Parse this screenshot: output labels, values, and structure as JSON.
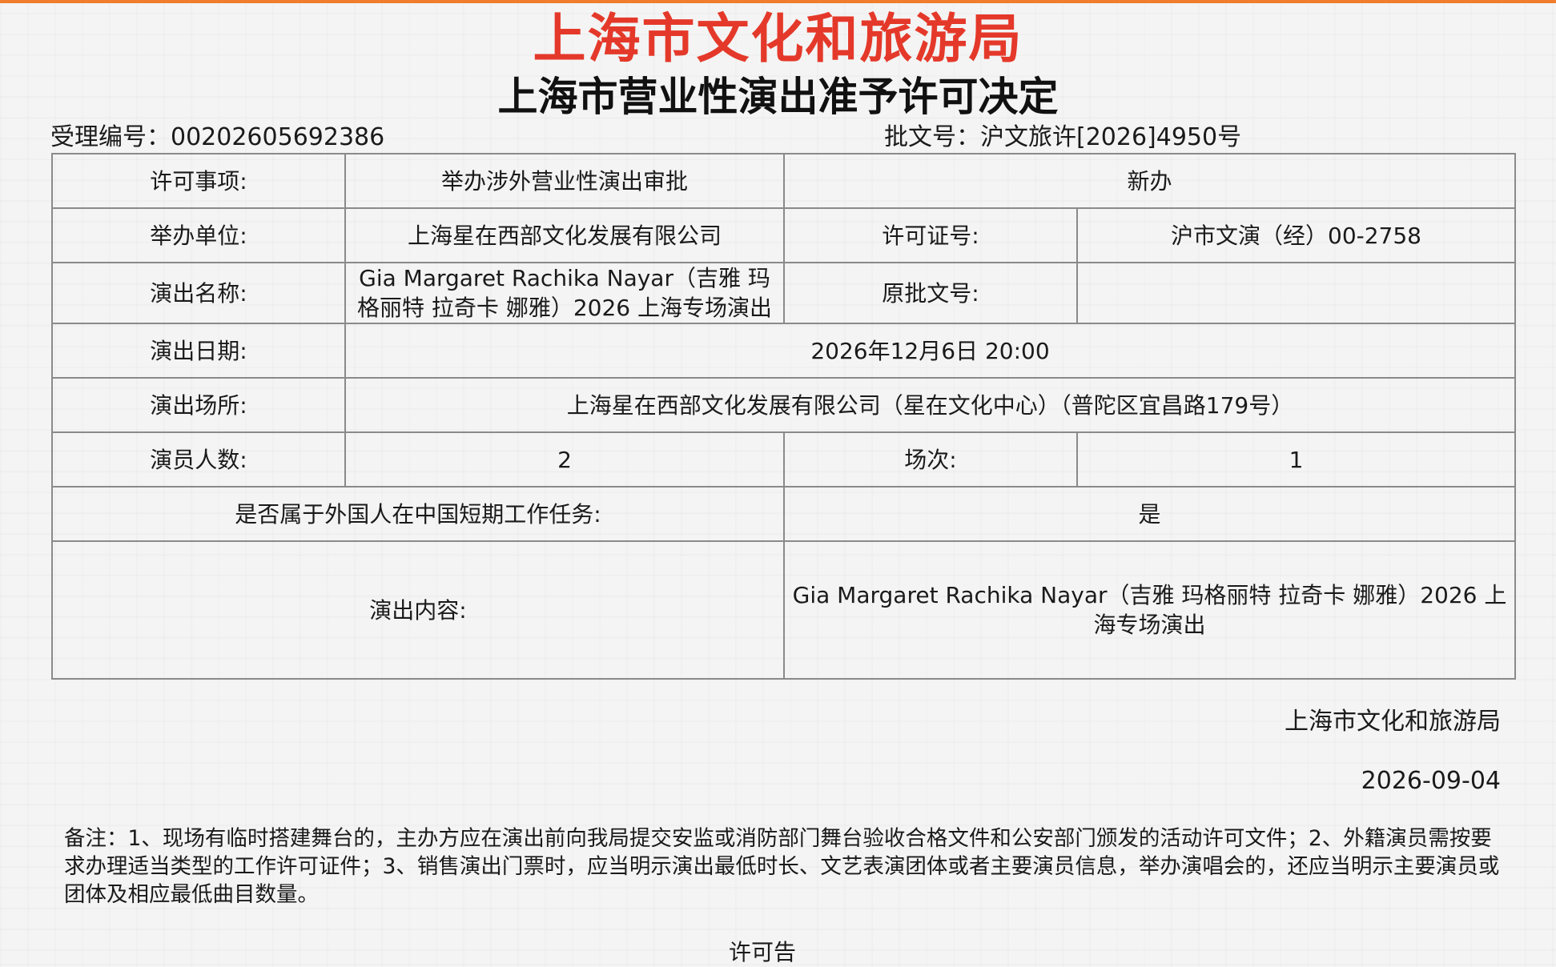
{
  "header": {
    "issuer_title": "上海市文化和旅游局",
    "document_title": "上海市营业性演出准予许可决定",
    "acceptance_no": "受理编号：00202605692386",
    "approval_no": "批文号：沪文旅许[2026]4950号"
  },
  "table": {
    "permit_item_label": "许可事项:",
    "permit_item_value": "举办涉外营业性演出审批",
    "permit_type_value": "新办",
    "organizer_label": "举办单位:",
    "organizer_value": "上海星在西部文化发展有限公司",
    "license_no_label": "许可证号:",
    "license_no_value": "沪市文演（经）00-2758",
    "show_name_label": "演出名称:",
    "show_name_value": "Gia Margaret Rachika Nayar（吉雅 玛格丽特 拉奇卡 娜雅）2026 上海专场演出",
    "original_approval_label": "原批文号:",
    "original_approval_value": "",
    "show_date_label": "演出日期:",
    "show_date_value": "2026年12月6日 20:00",
    "venue_label": "演出场所:",
    "venue_value": "上海星在西部文化发展有限公司（星在文化中心）（普陀区宜昌路179号）",
    "performer_count_label": "演员人数:",
    "performer_count_value": "2",
    "sessions_label": "场次:",
    "sessions_value": "1",
    "foreign_work_label": "是否属于外国人在中国短期工作任务:",
    "foreign_work_value": "是",
    "content_label": "演出内容:",
    "content_value": "Gia Margaret Rachika Nayar（吉雅 玛格丽特 拉奇卡 娜雅）2026 上海专场演出"
  },
  "footer": {
    "issuer": "上海市文化和旅游局",
    "issue_date": "2026-09-04",
    "remarks": "备注：1、现场有临时搭建舞台的，主办方应在演出前向我局提交安监或消防部门舞台验收合格文件和公安部门颁发的活动许可文件；2、外籍演员需按要求办理适当类型的工作许可证件；3、销售演出门票时，应当明示演出最低时长、文艺表演团体或者主要演员信息，举办演唱会的，还应当明示主要演员或团体及相应最低曲目数量。",
    "cut_off_text": "许可告"
  }
}
